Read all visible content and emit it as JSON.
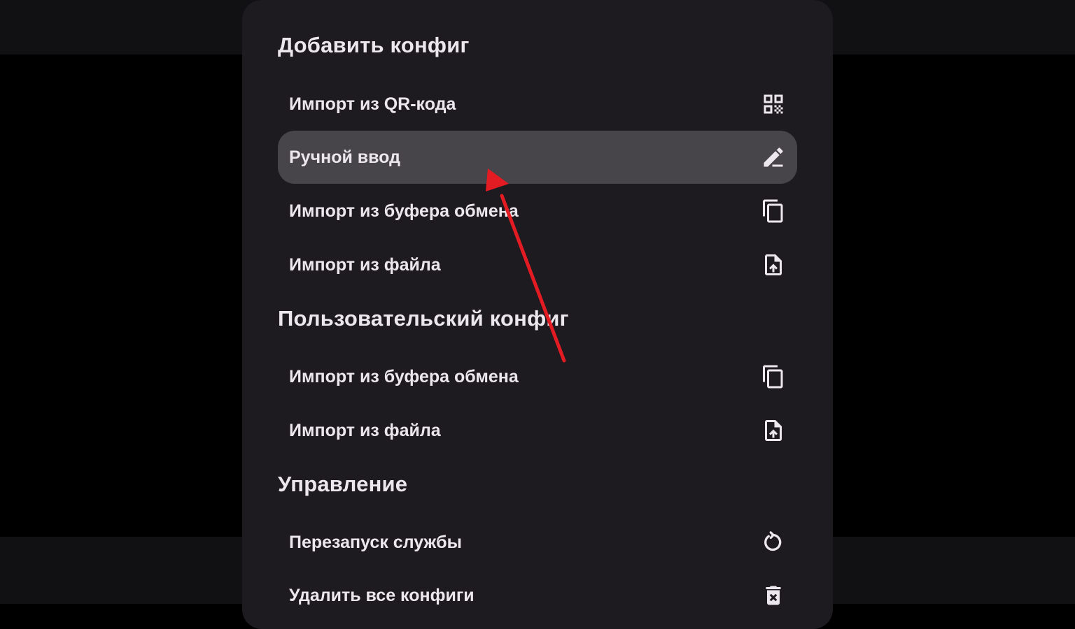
{
  "sections": [
    {
      "title": "Добавить конфиг",
      "items": [
        {
          "label": "Импорт из QR-кода",
          "icon": "qr-code-icon"
        },
        {
          "label": "Ручной ввод",
          "icon": "pencil-icon",
          "selected": true
        },
        {
          "label": "Импорт из буфера обмена",
          "icon": "copy-icon"
        },
        {
          "label": "Импорт из файла",
          "icon": "file-upload-icon"
        }
      ]
    },
    {
      "title": "Пользовательский конфиг",
      "items": [
        {
          "label": "Импорт из буфера обмена",
          "icon": "copy-icon"
        },
        {
          "label": "Импорт из файла",
          "icon": "file-upload-icon"
        }
      ]
    },
    {
      "title": "Управление",
      "items": [
        {
          "label": "Перезапуск службы",
          "icon": "restart-icon"
        },
        {
          "label": "Удалить все конфиги",
          "icon": "delete-icon"
        }
      ]
    }
  ],
  "colors": {
    "sheet_background": "#1e1b20",
    "selected_item_background": "#47444a",
    "text": "#ece7ee",
    "annotation_arrow": "#e31b23"
  }
}
